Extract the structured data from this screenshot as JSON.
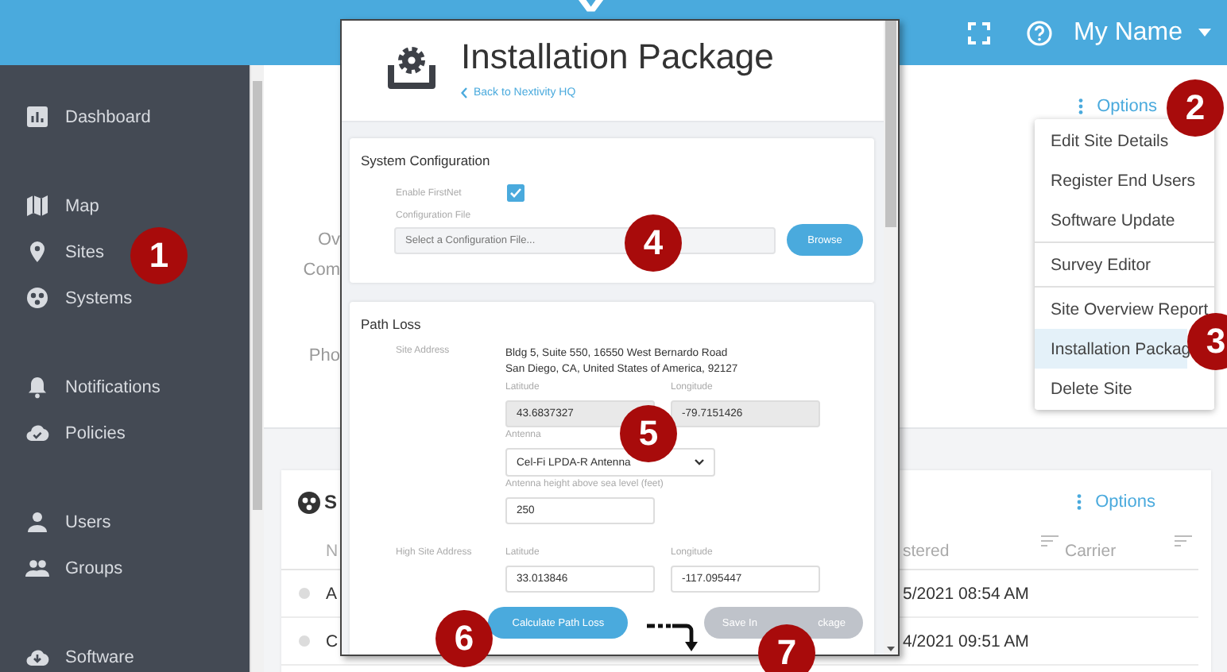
{
  "header": {
    "user_name": "My Name"
  },
  "sidebar": {
    "groups": [
      [
        "Dashboard"
      ],
      [
        "Map",
        "Sites",
        "Systems"
      ],
      [
        "Notifications",
        "Policies"
      ],
      [
        "Users",
        "Groups"
      ],
      [
        "Software"
      ]
    ]
  },
  "site_detail": {
    "labels": [
      "Ov",
      "Com",
      "Pho"
    ],
    "options_link": "Options"
  },
  "options_menu": {
    "sections": [
      [
        {
          "label": "Edit Site Details",
          "selected": false
        },
        {
          "label": "Register End Users",
          "selected": false
        },
        {
          "label": "Software Update",
          "selected": false
        }
      ],
      [
        {
          "label": "Survey Editor",
          "selected": false
        }
      ],
      [
        {
          "label": "Site Overview Report",
          "selected": false
        },
        {
          "label": "Installation Packag",
          "selected": true
        },
        {
          "label": "Delete Site",
          "selected": false
        }
      ]
    ]
  },
  "systems_card": {
    "title": "S",
    "options_link": "Options",
    "columns": [
      "N",
      "stered",
      "Carrier"
    ],
    "rows": [
      {
        "selected": false,
        "cells": [
          "A",
          "5/2021 08:54 AM"
        ]
      },
      {
        "selected": false,
        "cells": [
          "C",
          "4/2021 09:51 AM"
        ]
      }
    ]
  },
  "modal": {
    "title": "Installation Package",
    "back_link": "Back to Nextivity HQ",
    "system_configuration": {
      "title": "System Configuration",
      "enable_firstnet": {
        "label": "Enable FirstNet",
        "checked": true
      },
      "config_file": {
        "label": "Configuration File",
        "placeholder": "Select a Configuration File...",
        "button": "Browse"
      }
    },
    "path_loss": {
      "title": "Path Loss",
      "site_address_label": "Site Address",
      "address_lines": [
        "Bldg 5, Suite 550, 16550 West Bernardo Road",
        "San Diego, CA, United States of America, 92127"
      ],
      "latitude": {
        "label": "Latitude",
        "value": "43.6837327",
        "disabled": true
      },
      "longitude": {
        "label": "Longitude",
        "value": "-79.7151426",
        "disabled": true
      },
      "antenna": {
        "label": "Antenna",
        "value": "Cel-Fi LPDA-R Antenna"
      },
      "height": {
        "label": "Antenna height above sea level (feet)",
        "value": "250"
      },
      "high_site_label": "High Site Address",
      "high_latitude": {
        "label": "Latitude",
        "value": "33.013846",
        "disabled": false
      },
      "high_longitude": {
        "label": "Longitude",
        "value": "-117.095447",
        "disabled": false
      }
    },
    "buttons": [
      {
        "label": "Calculate Path Loss",
        "disabled": false
      },
      {
        "label_parts": [
          "Save In",
          "ckage"
        ],
        "disabled": true
      }
    ]
  },
  "callouts": [
    "1",
    "2",
    "3",
    "4",
    "5",
    "6",
    "7"
  ]
}
